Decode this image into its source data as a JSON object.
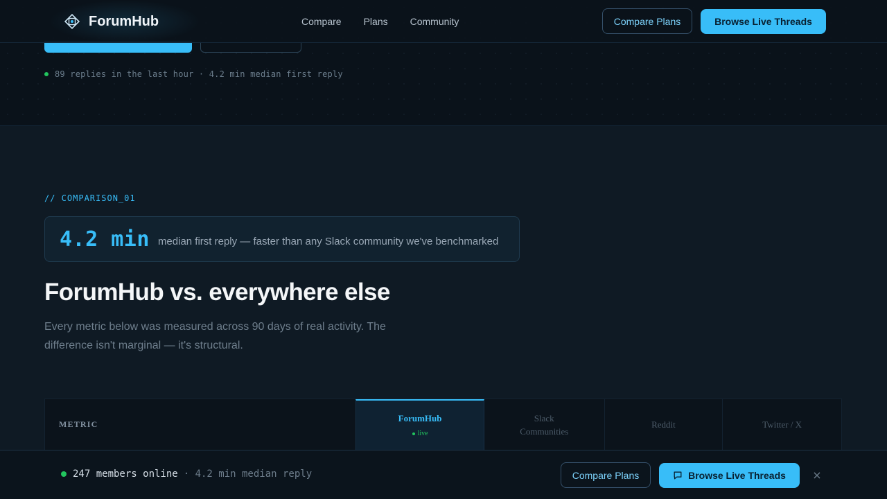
{
  "nav": {
    "brand": "ForumHub",
    "links": [
      "Compare",
      "Plans",
      "Community"
    ],
    "compare_label": "Compare Plans",
    "browse_label": "Browse Live Threads"
  },
  "hero": {
    "activity": "89 replies in the last hour · 4.2 min median first reply"
  },
  "comparison": {
    "tag": "// COMPARISON_01",
    "stat_value": "4.2 min",
    "stat_desc": "median first reply — faster than any Slack community we've benchmarked",
    "heading": "ForumHub vs. everywhere else",
    "subtitle": "Every metric below was measured across 90 days of real activity. The difference isn't marginal — it's structural.",
    "table": {
      "metric_header": "METRIC",
      "forumhub": "ForumHub",
      "forumhub_status": "live",
      "slack": "Slack Communities",
      "reddit": "Reddit",
      "twitter": "Twitter / X"
    }
  },
  "sticky_bar": {
    "online_count": "247 members online",
    "online_rest": "· 4.2 min median reply",
    "compare_label": "Compare Plans",
    "browse_label": "Browse Live Threads",
    "close": "×"
  },
  "colors": {
    "accent": "#38bdf8",
    "online": "#22c55e",
    "background": "#0f1a24"
  }
}
